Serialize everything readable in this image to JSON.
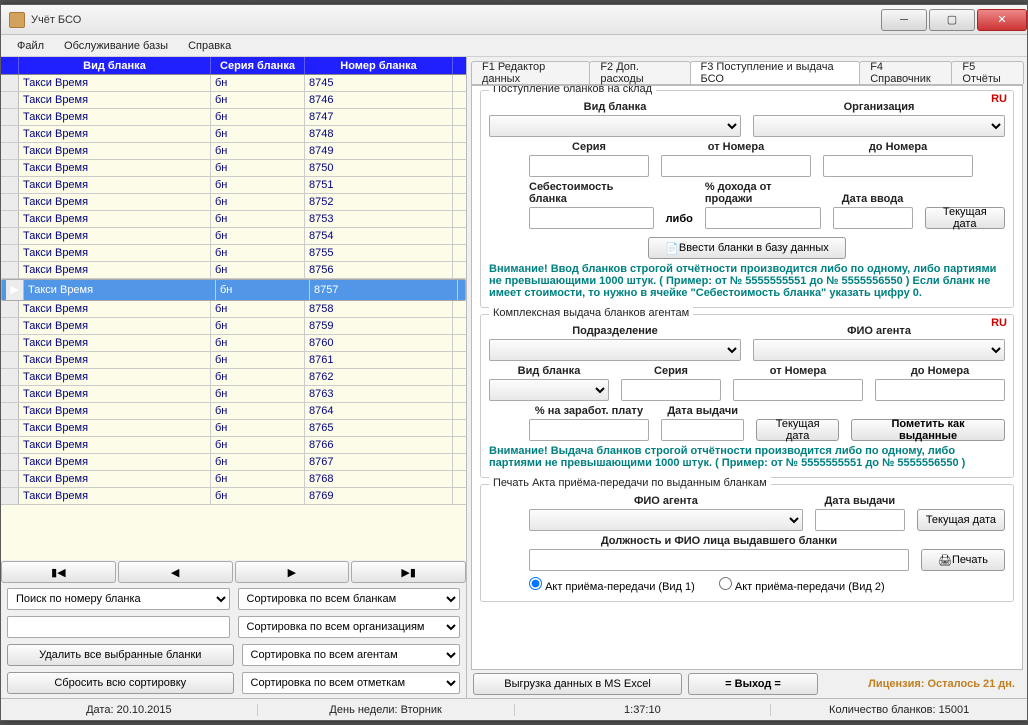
{
  "window": {
    "title": "Учёт БСО"
  },
  "menu": {
    "file": "Файл",
    "maintenance": "Обслуживание базы",
    "help": "Справка"
  },
  "grid": {
    "cols": {
      "c1": "",
      "c2": "Вид бланка",
      "c3": "Серия бланка",
      "c4": "Номер бланка"
    },
    "selected_index": 12,
    "rows": [
      {
        "kind": "Такси Время",
        "series": "бн",
        "num": "8745"
      },
      {
        "kind": "Такси Время",
        "series": "бн",
        "num": "8746"
      },
      {
        "kind": "Такси Время",
        "series": "бн",
        "num": "8747"
      },
      {
        "kind": "Такси Время",
        "series": "бн",
        "num": "8748"
      },
      {
        "kind": "Такси Время",
        "series": "бн",
        "num": "8749"
      },
      {
        "kind": "Такси Время",
        "series": "бн",
        "num": "8750"
      },
      {
        "kind": "Такси Время",
        "series": "бн",
        "num": "8751"
      },
      {
        "kind": "Такси Время",
        "series": "бн",
        "num": "8752"
      },
      {
        "kind": "Такси Время",
        "series": "бн",
        "num": "8753"
      },
      {
        "kind": "Такси Время",
        "series": "бн",
        "num": "8754"
      },
      {
        "kind": "Такси Время",
        "series": "бн",
        "num": "8755"
      },
      {
        "kind": "Такси Время",
        "series": "бн",
        "num": "8756"
      },
      {
        "kind": "Такси Время",
        "series": "бн",
        "num": "8757"
      },
      {
        "kind": "Такси Время",
        "series": "бн",
        "num": "8758"
      },
      {
        "kind": "Такси Время",
        "series": "бн",
        "num": "8759"
      },
      {
        "kind": "Такси Время",
        "series": "бн",
        "num": "8760"
      },
      {
        "kind": "Такси Время",
        "series": "бн",
        "num": "8761"
      },
      {
        "kind": "Такси Время",
        "series": "бн",
        "num": "8762"
      },
      {
        "kind": "Такси Время",
        "series": "бн",
        "num": "8763"
      },
      {
        "kind": "Такси Время",
        "series": "бн",
        "num": "8764"
      },
      {
        "kind": "Такси Время",
        "series": "бн",
        "num": "8765"
      },
      {
        "kind": "Такси Время",
        "series": "бн",
        "num": "8766"
      },
      {
        "kind": "Такси Время",
        "series": "бн",
        "num": "8767"
      },
      {
        "kind": "Такси Время",
        "series": "бн",
        "num": "8768"
      },
      {
        "kind": "Такси Время",
        "series": "бн",
        "num": "8769"
      }
    ]
  },
  "left": {
    "search_sel": "Поиск по номеру бланка",
    "sort_blanks": "Сортировка по всем бланкам",
    "sort_orgs": "Сортировка по всем организациям",
    "sort_agents": "Сортировка по всем агентам",
    "sort_marks": "Сортировка по всем отметкам",
    "delete_btn": "Удалить все выбранные бланки",
    "reset_btn": "Сбросить всю сортировку"
  },
  "tabs": {
    "t1": "F1 Редактор данных",
    "t2": "F2 Доп. расходы",
    "t3": "F3 Поступление и выдача БСО",
    "t4": "F4 Справочник",
    "t5": "F5 Отчёты"
  },
  "group1": {
    "legend": "Поступление бланков на склад",
    "ru": "RU",
    "kind": "Вид бланка",
    "org": "Организация",
    "series": "Серия",
    "from_num": "от Номера",
    "to_num": "до Номера",
    "cost": "Себестоимость бланка",
    "or": "либо",
    "percent": "% дохода от продажи",
    "date_in": "Дата ввода",
    "cur_date": "Текущая дата",
    "enter_btn": "Ввести бланки в базу данных",
    "note": "Внимание! Ввод бланков строгой отчётности производится либо по одному, либо партиями не превышающими 1000 штук. ( Пример: от № 5555555551 до № 5555556550 ) Если бланк не имеет стоимости, то нужно в ячейке \"Себестоимость бланка\" указать цифру 0."
  },
  "group2": {
    "legend": "Комплексная выдача бланков агентам",
    "ru": "RU",
    "dept": "Подразделение",
    "agent": "ФИО агента",
    "kind": "Вид бланка",
    "series": "Серия",
    "from_num": "от Номера",
    "to_num": "до Номера",
    "percent_salary": "% на заработ. плату",
    "date_out": "Дата выдачи",
    "cur_date": "Текущая дата",
    "mark_btn": "Пометить как выданные",
    "note": "Внимание! Выдача бланков строгой отчётности производится либо по одному, либо партиями не превышающими 1000 штук. ( Пример: от № 5555555551 до № 5555556550 )"
  },
  "group3": {
    "legend": "Печать Акта приёма-передачи по выданным бланкам",
    "agent": "ФИО агента",
    "date_out": "Дата выдачи",
    "cur_date": "Текущая дата",
    "position": "Должность и ФИО лица выдавшего бланки",
    "print": "Печать",
    "radio1": "Акт приёма-передачи (Вид 1)",
    "radio2": "Акт приёма-передачи (Вид 2)"
  },
  "bottom": {
    "export": "Выгрузка данных в MS Excel",
    "exit": "= Выход =",
    "license": "Лицензия: Осталось 21 дн."
  },
  "status": {
    "date": "Дата: 20.10.2015",
    "day": "День недели: Вторник",
    "time": "1:37:10",
    "count": "Количество бланков: 15001"
  }
}
